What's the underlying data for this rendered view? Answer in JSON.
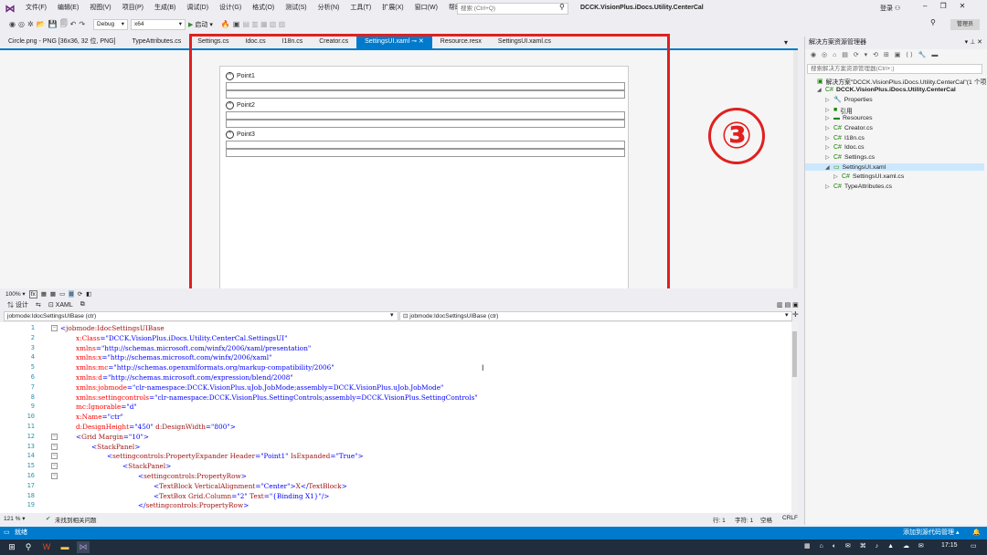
{
  "menubar": {
    "items": [
      "文件(F)",
      "编辑(E)",
      "视图(V)",
      "项目(P)",
      "生成(B)",
      "调试(D)",
      "设计(G)",
      "格式(O)",
      "测试(S)",
      "分析(N)",
      "工具(T)",
      "扩展(X)",
      "窗口(W)",
      "帮助(H)"
    ],
    "search_placeholder": "搜索 (Ctrl+Q)",
    "solution_name": "DCCK.VisionPlus.iDocs.Utility.CenterCal",
    "login": "登录"
  },
  "toolbar": {
    "config": "Debug",
    "platform": "x64",
    "start": "启动",
    "admin_badge": "管理员"
  },
  "tabs": [
    {
      "label": "Circle.png - PNG [36x36, 32 位, PNG]",
      "active": false
    },
    {
      "label": "TypeAttributes.cs",
      "active": false
    },
    {
      "label": "Settings.cs",
      "active": false
    },
    {
      "label": "Idoc.cs",
      "active": false
    },
    {
      "label": "I18n.cs",
      "active": false
    },
    {
      "label": "Creator.cs",
      "active": false
    },
    {
      "label": "SettingsUI.xaml",
      "active": true
    },
    {
      "label": "Resource.resx",
      "active": false
    },
    {
      "label": "SettingsUI.xaml.cs",
      "active": false
    }
  ],
  "designer": {
    "expanders": [
      "Point1",
      "Point2",
      "Point3"
    ],
    "annotation": "③",
    "zoom": "100%"
  },
  "views": {
    "design": "设计",
    "xaml": "XAML"
  },
  "nav": {
    "left": "jobmode:IdocSettingsUIBase (ctr)",
    "right": "jobmode:IdocSettingsUIBase (ctr)"
  },
  "code_lines": [
    {
      "n": "1",
      "indent": 0,
      "text": "<jobmode:IdocSettingsUIBase",
      "fold": true
    },
    {
      "n": "2",
      "indent": 1,
      "text": "x:Class=\"DCCK.VisionPlus.iDocs.Utility.CenterCal.SettingsUI\"",
      "fold": false
    },
    {
      "n": "3",
      "indent": 1,
      "text": "xmlns=\"http://schemas.microsoft.com/winfx/2006/xaml/presentation\"",
      "fold": false
    },
    {
      "n": "4",
      "indent": 1,
      "text": "xmlns:x=\"http://schemas.microsoft.com/winfx/2006/xaml\"",
      "fold": false
    },
    {
      "n": "5",
      "indent": 1,
      "text": "xmlns:mc=\"http://schemas.openxmlformats.org/markup-compatibility/2006\"",
      "fold": false
    },
    {
      "n": "6",
      "indent": 1,
      "text": "xmlns:d=\"http://schemas.microsoft.com/expression/blend/2008\"",
      "fold": false
    },
    {
      "n": "7",
      "indent": 1,
      "text": "xmlns:jobmode=\"clr-namespace:DCCK.VisionPlus.uJob.JobMode;assembly=DCCK.VisionPlus.uJob.JobMode\"",
      "fold": false
    },
    {
      "n": "8",
      "indent": 1,
      "text": "xmlns:settingcontrols=\"clr-namespace:DCCK.VisionPlus.SettingControls;assembly=DCCK.VisionPlus.SettingControls\"",
      "fold": false
    },
    {
      "n": "9",
      "indent": 1,
      "text": "mc:Ignorable=\"d\"",
      "fold": false
    },
    {
      "n": "10",
      "indent": 1,
      "text": "x:Name=\"ctr\"",
      "fold": false
    },
    {
      "n": "11",
      "indent": 1,
      "text": "d:DesignHeight=\"450\" d:DesignWidth=\"800\">",
      "fold": false
    },
    {
      "n": "12",
      "indent": 1,
      "text": "<Grid Margin=\"10\">",
      "fold": true
    },
    {
      "n": "13",
      "indent": 2,
      "text": "<StackPanel>",
      "fold": true
    },
    {
      "n": "14",
      "indent": 3,
      "text": "<settingcontrols:PropertyExpander Header=\"Point1\" IsExpanded=\"True\">",
      "fold": true
    },
    {
      "n": "15",
      "indent": 4,
      "text": "<StackPanel>",
      "fold": true
    },
    {
      "n": "16",
      "indent": 5,
      "text": "<settingcontrols:PropertyRow>",
      "fold": true
    },
    {
      "n": "17",
      "indent": 6,
      "text": "<TextBlock VerticalAlignment=\"Center\">X</TextBlock>",
      "fold": false
    },
    {
      "n": "18",
      "indent": 6,
      "text": "<TextBox Grid.Column=\"2\" Text=\"{Binding X1}\"/>",
      "fold": false
    },
    {
      "n": "19",
      "indent": 5,
      "text": "</settingcontrols:PropertyRow>",
      "fold": false
    }
  ],
  "editor_status": {
    "zoom": "121 %",
    "issues": "未找到相关问题",
    "line": "行: 1",
    "char": "字符: 1",
    "spaces": "空格",
    "eol": "CRLF"
  },
  "solution_explorer": {
    "title": "解决方案资源管理器",
    "search_placeholder": "搜索解决方案资源管理器(Ctrl+;)",
    "items": [
      {
        "label": "解决方案\"DCCK.VisionPlus.iDocs.Utility.CenterCal\"(1 个项目",
        "level": 0,
        "arrow": "",
        "icon": "▣",
        "bold": false,
        "selected": false
      },
      {
        "label": "DCCK.VisionPlus.iDocs.Utility.CenterCal",
        "level": 1,
        "arrow": "◢",
        "icon": "C#",
        "bold": true,
        "selected": false
      },
      {
        "label": "Properties",
        "level": 2,
        "arrow": "▷",
        "icon": "🔧",
        "bold": false,
        "selected": false
      },
      {
        "label": "引用",
        "level": 2,
        "arrow": "▷",
        "icon": "■",
        "bold": false,
        "selected": false
      },
      {
        "label": "Resources",
        "level": 2,
        "arrow": "▷",
        "icon": "▬",
        "bold": false,
        "selected": false
      },
      {
        "label": "Creator.cs",
        "level": 2,
        "arrow": "▷",
        "icon": "C#",
        "bold": false,
        "selected": false
      },
      {
        "label": "I18n.cs",
        "level": 2,
        "arrow": "▷",
        "icon": "C#",
        "bold": false,
        "selected": false
      },
      {
        "label": "Idoc.cs",
        "level": 2,
        "arrow": "▷",
        "icon": "C#",
        "bold": false,
        "selected": false
      },
      {
        "label": "Settings.cs",
        "level": 2,
        "arrow": "▷",
        "icon": "C#",
        "bold": false,
        "selected": false
      },
      {
        "label": "SettingsUI.xaml",
        "level": 2,
        "arrow": "◢",
        "icon": "▭",
        "bold": false,
        "selected": true
      },
      {
        "label": "SettingsUI.xaml.cs",
        "level": 3,
        "arrow": "▷",
        "icon": "C#",
        "bold": false,
        "selected": false
      },
      {
        "label": "TypeAttributes.cs",
        "level": 2,
        "arrow": "▷",
        "icon": "C#",
        "bold": false,
        "selected": false
      }
    ]
  },
  "statusbar": {
    "left": "就绪",
    "right": "添加到源代码管理 ▴"
  },
  "taskbar": {
    "time": "17:15"
  },
  "colors": {
    "accent": "#007acc",
    "annotation_red": "#e02020",
    "xml_tag": "#a31515",
    "xml_attr": "#ff0000",
    "xml_value": "#0000ff"
  }
}
